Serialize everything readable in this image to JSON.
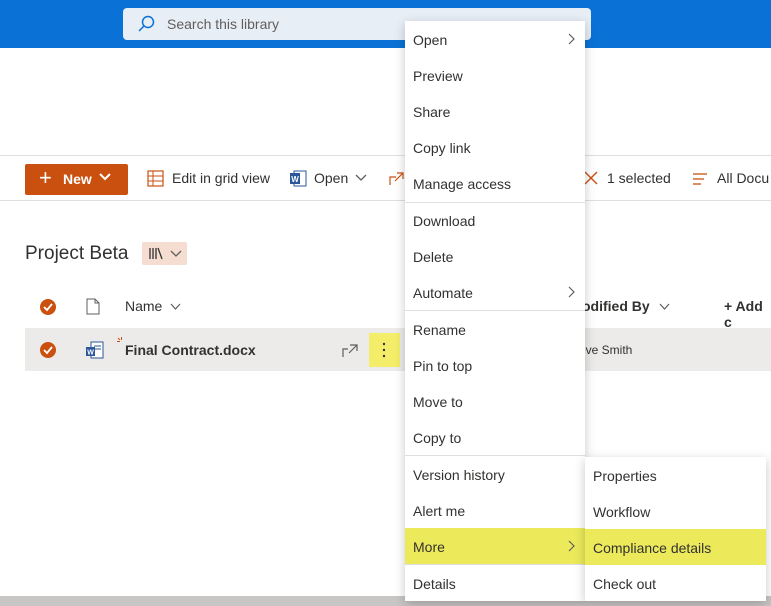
{
  "search": {
    "placeholder": "Search this library"
  },
  "command_bar": {
    "new_label": "New",
    "edit_grid_label": "Edit in grid view",
    "open_label": "Open",
    "selected_label": "1 selected",
    "view_label": "All Docu"
  },
  "library": {
    "title": "Project Beta"
  },
  "columns": {
    "name": "Name",
    "modified_by": "odified By",
    "add_column": "+ Add c"
  },
  "file": {
    "name": "Final Contract.docx",
    "modified_by": "eve Smith"
  },
  "context_menu": {
    "items": [
      {
        "label": "Open",
        "submenu": true
      },
      {
        "label": "Preview"
      },
      {
        "label": "Share"
      },
      {
        "label": "Copy link"
      },
      {
        "label": "Manage access"
      },
      {
        "label": "Download"
      },
      {
        "label": "Delete"
      },
      {
        "label": "Automate",
        "submenu": true
      },
      {
        "label": "Rename"
      },
      {
        "label": "Pin to top"
      },
      {
        "label": "Move to"
      },
      {
        "label": "Copy to"
      },
      {
        "label": "Version history"
      },
      {
        "label": "Alert me"
      },
      {
        "label": "More",
        "submenu": true,
        "highlighted": true
      },
      {
        "label": "Details"
      }
    ]
  },
  "more_submenu": {
    "items": [
      {
        "label": "Properties"
      },
      {
        "label": "Workflow"
      },
      {
        "label": "Compliance details",
        "highlighted": true
      },
      {
        "label": "Check out"
      }
    ]
  },
  "colors": {
    "brand": "#0a72d6",
    "accent": "#ca5010",
    "highlight": "#ecea5a"
  }
}
